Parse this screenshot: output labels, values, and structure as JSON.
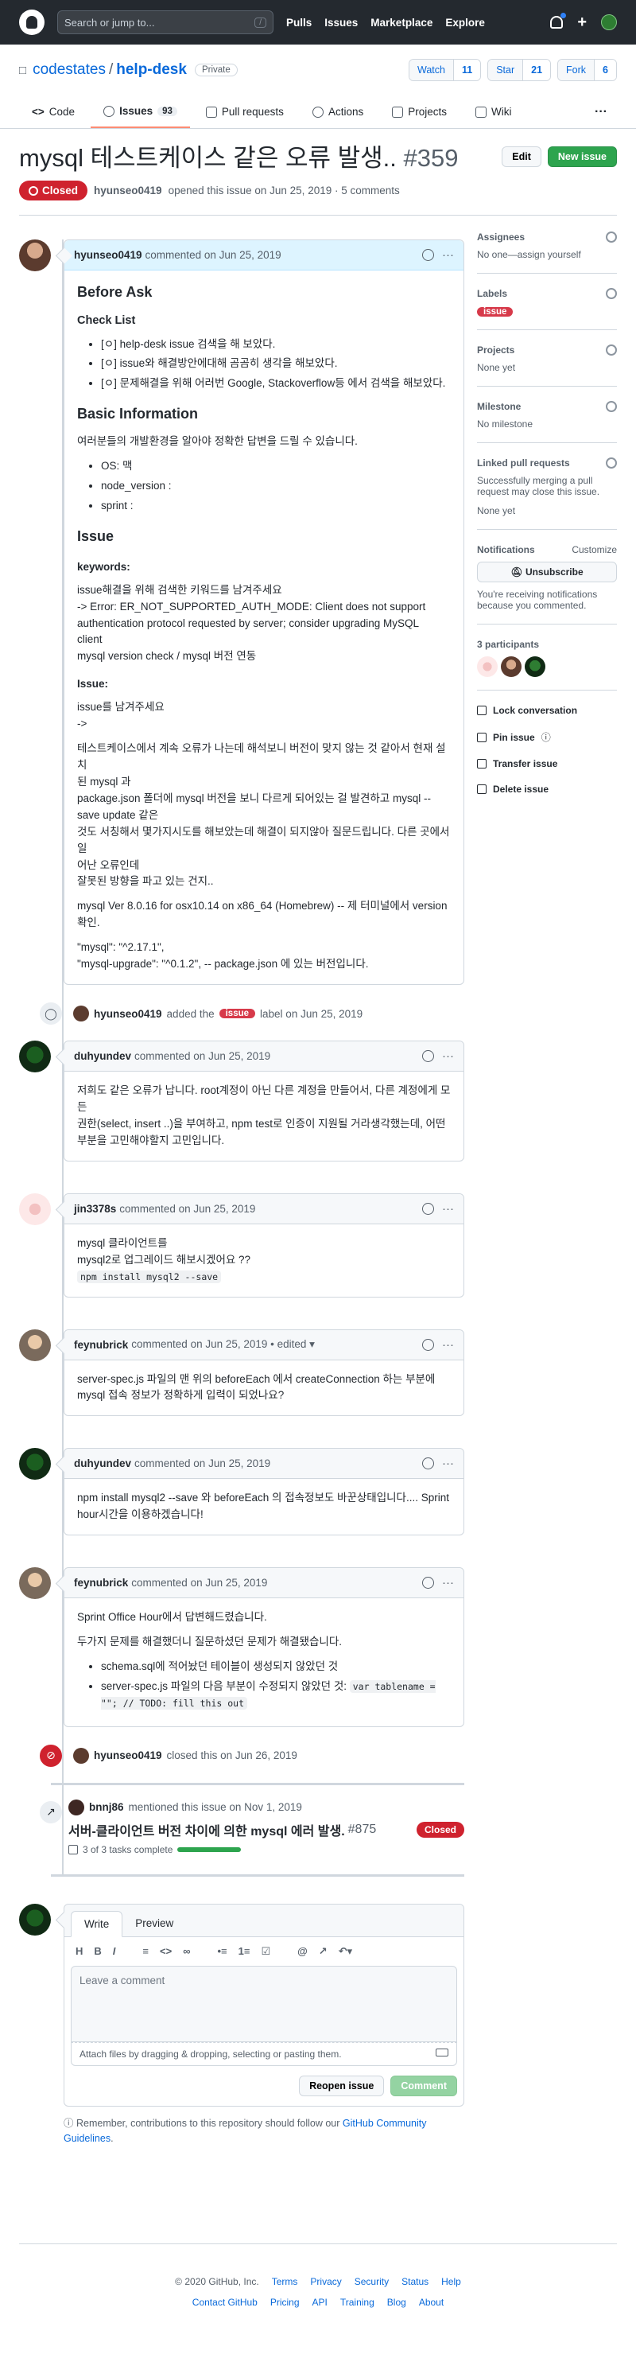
{
  "nav": {
    "search_placeholder": "Search or jump to...",
    "search_key": "/",
    "links": [
      "Pulls",
      "Issues",
      "Marketplace",
      "Explore"
    ],
    "plus": "+"
  },
  "repo": {
    "owner": "codestates",
    "sep": "/",
    "name": "help-desk",
    "visibility": "Private",
    "watch_label": "Watch",
    "watch_count": "11",
    "star_label": "Star",
    "star_count": "21",
    "fork_label": "Fork",
    "fork_count": "6",
    "tabs": {
      "code": "Code",
      "issues": "Issues",
      "issues_count": "93",
      "pulls": "Pull requests",
      "actions": "Actions",
      "projects": "Projects",
      "wiki": "Wiki",
      "more": "···"
    }
  },
  "issue": {
    "title": "mysql 테스트케이스 같은 오류 발생..",
    "number": "#359",
    "edit_label": "Edit",
    "new_label": "New issue",
    "state": "Closed",
    "author": "hyunseo0419",
    "opened_text": "opened this issue on Jun 25, 2019 · 5 comments"
  },
  "comments": [
    {
      "author": "hyunseo0419",
      "date_text": "commented on Jun 25, 2019",
      "body": {
        "h_before": "Before Ask",
        "h_checklist": "Check List",
        "checklist": [
          "[ㅇ] help-desk issue 검색을 해 보았다.",
          "[ㅇ] issue와 해결방안에대해 곰곰히 생각을 해보았다.",
          "[ㅇ] 문제해결을 위해 어러번 Google, Stackoverflow등 에서 검색을 해보았다."
        ],
        "h_basic": "Basic Information",
        "basic_intro": "여러분들의 개발환경을 알아야 정확한 답변을 드릴 수 있습니다.",
        "basic_items": [
          "OS: 맥",
          "node_version :",
          "sprint :"
        ],
        "h_issue": "Issue",
        "h_keywords": "keywords:",
        "keywords_lines": [
          "issue해결을 위해 검색한 키워드를 남겨주세요",
          "-> Error: ER_NOT_SUPPORTED_AUTH_MODE: Client does not support",
          "authentication protocol requested by server; consider upgrading MySQL",
          "client",
          "mysql version check / mysql 버전 연동"
        ],
        "h_issue2": "Issue:",
        "issue_lines": [
          "issue를 남겨주세요",
          "->"
        ],
        "issue_detail_lines": [
          "테스트케이스에서 계속 오류가 나는데 해석보니 버전이 맞지 않는 것 같아서 현재 설치",
          "된 mysql 과",
          "package.json 폴더에 mysql 버전을 보니 다르게 되어있는 걸 발견하고 mysql --",
          "save update 같은",
          "것도 서칭해서 몇가지시도를 해보았는데 해결이 되지않아 질문드립니다. 다른 곳에서 일",
          "어난 오류인데",
          "잘못된 방향을 파고 있는 건지.."
        ],
        "version_lines": [
          "mysql Ver 8.0.16 for osx10.14 on x86_64 (Homebrew) -- 제 터미널에서 version",
          "확인."
        ],
        "pkg_lines": [
          "\"mysql\": \"^2.17.1\",",
          "\"mysql-upgrade\": \"^0.1.2\", -- package.json 에 있는 버전입니다."
        ]
      }
    },
    {
      "author": "duhyundev",
      "date_text": "commented on Jun 25, 2019",
      "lines": [
        "저희도 같은 오류가 납니다. root계정이 아닌 다른 계정을 만들어서, 다른 계정에게 모든",
        "권한(select, insert ..)을 부여하고, npm test로 인증이 지원될 거라생각했는데, 어떤",
        "부분을 고민해야할지 고민입니다."
      ]
    },
    {
      "author": "jin3378s",
      "date_text": "commented on Jun 25, 2019",
      "lines": [
        "mysql 클라이언트를",
        "mysql2로 업그레이드 해보시겠어요 ??"
      ],
      "code": "npm install mysql2 --save"
    },
    {
      "author": "feynubrick",
      "date_text": "commented on Jun 25, 2019 • edited ▾",
      "lines": [
        "server-spec.js 파일의 맨 위의 beforeEach 에서 createConnection 하는 부분에",
        "mysql 접속 정보가 정확하게 입력이 되었나요?"
      ]
    },
    {
      "author": "duhyundev",
      "date_text": "commented on Jun 25, 2019",
      "lines": [
        "npm install mysql2 --save 와 beforeEach 의 접속정보도 바꾼상태입니다.... Sprint",
        "hour시간을 이용하겠습니다!"
      ]
    },
    {
      "author": "feynubrick",
      "date_text": "commented on Jun 25, 2019",
      "p1": "Sprint Office Hour에서 답변해드렸습니다.",
      "p2": "두가지 문제를 해결했더니 질문하셨던 문제가 해결됐습니다.",
      "item1": "schema.sql에 적어놨던 테이블이 생성되지 않았던 것",
      "item2_text": "server-spec.js 파일의 다음 부분이 수정되지 않았던 것: ",
      "item2_code": "var tablename = \"\"; // TODO: fill this out"
    }
  ],
  "events": {
    "label_actor": "hyunseo0419",
    "label_text": "added the",
    "label_name": "issue",
    "label_suffix": "label on Jun 25, 2019",
    "closed_actor": "hyunseo0419",
    "closed_text": "closed this on Jun 26, 2019",
    "mention_actor": "bnnj86",
    "mention_text": "mentioned this issue on Nov 1, 2019",
    "ref_title": "서버-클라이언트 버전 차이에 의한 mysql 에러 발생.",
    "ref_number": "#875",
    "ref_state": "Closed",
    "ref_tasks": "3 of 3 tasks complete",
    "ref_tasks_done": 1.0
  },
  "editor": {
    "tab_write": "Write",
    "tab_preview": "Preview",
    "placeholder": "Leave a comment",
    "attach_text": "Attach files by dragging & dropping, selecting or pasting them.",
    "reopen_label": "Reopen issue",
    "comment_label": "Comment",
    "tip_text": "Remember, contributions to this repository should follow our ",
    "tip_link": "GitHub Community Guidelines",
    "tip_end": "."
  },
  "sidebar": {
    "assignees_h": "Assignees",
    "assignees_v": "No one—assign yourself",
    "labels_h": "Labels",
    "label": "issue",
    "projects_h": "Projects",
    "projects_v": "None yet",
    "milestone_h": "Milestone",
    "milestone_v": "No milestone",
    "linked_h": "Linked pull requests",
    "linked_desc": "Successfully merging a pull request may close this issue.",
    "linked_v": "None yet",
    "notif_h": "Notifications",
    "notif_customize": "Customize",
    "unsubscribe": "Unsubscribe",
    "notif_desc": "You're receiving notifications because you commented.",
    "participants": "3 participants",
    "lock": "Lock conversation",
    "pin": "Pin issue",
    "transfer": "Transfer issue",
    "delete": "Delete issue"
  },
  "footer": {
    "copyright": "© 2020 GitHub, Inc.",
    "row1": [
      "Terms",
      "Privacy",
      "Security",
      "Status",
      "Help"
    ],
    "row2": [
      "Contact GitHub",
      "Pricing",
      "API",
      "Training",
      "Blog",
      "About"
    ]
  },
  "colors": {
    "closed": "#cf222e",
    "accent": "#0969da",
    "green": "#2da44e",
    "label_issue": "#d73a4a"
  }
}
